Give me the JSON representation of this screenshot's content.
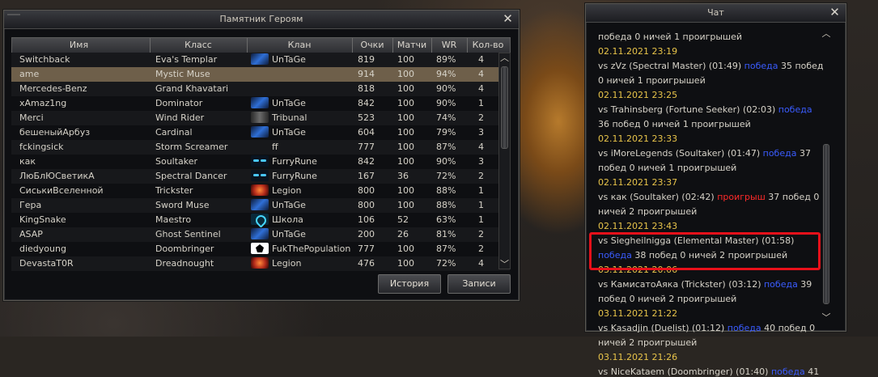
{
  "heroes_window": {
    "title": "Памятник Героям",
    "close_glyph": "✕",
    "columns": [
      "Имя",
      "Класс",
      "Клан",
      "Очки",
      "Матчи",
      "WR",
      "Кол-во"
    ],
    "rows": [
      {
        "name": "Switchback",
        "class": "Eva's Templar",
        "clan": "UnTaGe",
        "clan_icon": "untage-emblem-icon",
        "points": "819",
        "matches": "100",
        "wr": "89%",
        "count": "4"
      },
      {
        "name": "ame",
        "class": "Mystic Muse",
        "clan": "",
        "clan_icon": "",
        "points": "914",
        "matches": "100",
        "wr": "94%",
        "count": "4"
      },
      {
        "name": "Mercedes-Benz",
        "class": "Grand Khavatari",
        "clan": "",
        "clan_icon": "",
        "points": "818",
        "matches": "100",
        "wr": "90%",
        "count": "4"
      },
      {
        "name": "xAmaz1ng",
        "class": "Dominator",
        "clan": "UnTaGe",
        "clan_icon": "untage-emblem-icon",
        "points": "842",
        "matches": "100",
        "wr": "90%",
        "count": "1"
      },
      {
        "name": "Merci",
        "class": "Wind Rider",
        "clan": "Tribunal",
        "clan_icon": "tribunal-emblem-icon",
        "points": "523",
        "matches": "100",
        "wr": "74%",
        "count": "2"
      },
      {
        "name": "бешеныйАрбуз",
        "class": "Cardinal",
        "clan": "UnTaGe",
        "clan_icon": "untage-emblem-icon",
        "points": "604",
        "matches": "100",
        "wr": "79%",
        "count": "3"
      },
      {
        "name": "fckingsick",
        "class": "Storm Screamer",
        "clan": "ff",
        "clan_icon": "",
        "points": "777",
        "matches": "100",
        "wr": "87%",
        "count": "4"
      },
      {
        "name": "как",
        "class": "Soultaker",
        "clan": "FurryRune",
        "clan_icon": "furryrune-emblem-icon",
        "points": "842",
        "matches": "100",
        "wr": "90%",
        "count": "3"
      },
      {
        "name": "ЛюБлЮСветикА",
        "class": "Spectral Dancer",
        "clan": "FurryRune",
        "clan_icon": "furryrune-emblem-icon",
        "points": "167",
        "matches": "36",
        "wr": "72%",
        "count": "2"
      },
      {
        "name": "СиськиВселенной",
        "class": "Trickster",
        "clan": "Legion",
        "clan_icon": "legion-emblem-icon",
        "points": "800",
        "matches": "100",
        "wr": "88%",
        "count": "1"
      },
      {
        "name": "Гера",
        "class": "Sword Muse",
        "clan": "UnTaGe",
        "clan_icon": "untage-emblem-icon",
        "points": "800",
        "matches": "100",
        "wr": "88%",
        "count": "1"
      },
      {
        "name": "KingSnake",
        "class": "Maestro",
        "clan": "Школа",
        "clan_icon": "shkola-emblem-icon",
        "points": "106",
        "matches": "52",
        "wr": "63%",
        "count": "1"
      },
      {
        "name": "ASAP",
        "class": "Ghost Sentinel",
        "clan": "UnTaGe",
        "clan_icon": "untage-emblem-icon",
        "points": "200",
        "matches": "26",
        "wr": "81%",
        "count": "2"
      },
      {
        "name": "diedyoung",
        "class": "Doombringer",
        "clan": "FukThePopulation",
        "clan_icon": "fukthepopulation-emblem-icon",
        "points": "777",
        "matches": "100",
        "wr": "87%",
        "count": "2"
      },
      {
        "name": "DevastaT0R",
        "class": "Dreadnought",
        "clan": "Legion",
        "clan_icon": "legion-emblem-icon",
        "points": "476",
        "matches": "100",
        "wr": "72%",
        "count": "4"
      }
    ],
    "selected_row": 1,
    "buttons": {
      "history": "История",
      "records": "Записи"
    },
    "scroll_up": "︿",
    "scroll_down": "﹀"
  },
  "chat_window": {
    "title": "Чат",
    "close_glyph": "✕",
    "scroll_up": "︿",
    "scroll_down": "﹀",
    "lines": [
      {
        "parts": [
          {
            "t": "победа 0 ничей 1 проигрышей",
            "c": "normal"
          }
        ]
      },
      {
        "parts": [
          {
            "t": "02.11.2021 23:19",
            "c": "date"
          }
        ]
      },
      {
        "parts": [
          {
            "t": "vs zVz (Spectral Master) (01:49) ",
            "c": "normal"
          },
          {
            "t": "победа",
            "c": "win"
          },
          {
            "t": " 35 побед",
            "c": "normal"
          }
        ]
      },
      {
        "parts": [
          {
            "t": "0 ничей 1 проигрышей",
            "c": "normal"
          }
        ]
      },
      {
        "parts": [
          {
            "t": "02.11.2021 23:25",
            "c": "date"
          }
        ]
      },
      {
        "parts": [
          {
            "t": "vs Trahinsberg (Fortune Seeker) (02:03) ",
            "c": "normal"
          },
          {
            "t": "победа",
            "c": "win"
          }
        ]
      },
      {
        "parts": [
          {
            "t": "36 побед 0 ничей 1 проигрышей",
            "c": "normal"
          }
        ]
      },
      {
        "parts": [
          {
            "t": "02.11.2021 23:33",
            "c": "date"
          }
        ]
      },
      {
        "parts": [
          {
            "t": "vs iMoreLegends (Soultaker) (01:47) ",
            "c": "normal"
          },
          {
            "t": "победа",
            "c": "win"
          },
          {
            "t": " 37",
            "c": "normal"
          }
        ]
      },
      {
        "parts": [
          {
            "t": "побед 0 ничей 1 проигрышей",
            "c": "normal"
          }
        ]
      },
      {
        "parts": [
          {
            "t": "02.11.2021 23:37",
            "c": "date"
          }
        ]
      },
      {
        "parts": [
          {
            "t": "vs как (Soultaker) (02:42) ",
            "c": "normal"
          },
          {
            "t": "проигрыш",
            "c": "lose"
          },
          {
            "t": " 37 побед 0",
            "c": "normal"
          }
        ]
      },
      {
        "parts": [
          {
            "t": "ничей 2 проигрышей",
            "c": "normal"
          }
        ]
      },
      {
        "parts": [
          {
            "t": "02.11.2021 23:43",
            "c": "date"
          }
        ]
      },
      {
        "parts": [
          {
            "t": "vs Siegheilnigga (Elemental Master) (01:58)",
            "c": "normal"
          }
        ]
      },
      {
        "parts": [
          {
            "t": "победа",
            "c": "win"
          },
          {
            "t": " 38 побед 0 ничей 2 проигрышей",
            "c": "normal"
          }
        ]
      },
      {
        "parts": [
          {
            "t": "03.11.2021 20:06",
            "c": "date"
          }
        ]
      },
      {
        "parts": [
          {
            "t": "vs КамисатоАяка (Trickster) (03:12) ",
            "c": "normal"
          },
          {
            "t": "победа",
            "c": "win"
          },
          {
            "t": " 39",
            "c": "normal"
          }
        ]
      },
      {
        "parts": [
          {
            "t": "побед 0 ничей 2 проигрышей",
            "c": "normal"
          }
        ]
      },
      {
        "parts": [
          {
            "t": "03.11.2021 21:22",
            "c": "date"
          }
        ]
      },
      {
        "parts": [
          {
            "t": "vs Kasadjin (Duelist) (01:12) ",
            "c": "normal"
          },
          {
            "t": "победа",
            "c": "win"
          },
          {
            "t": " 40 побед 0",
            "c": "normal"
          }
        ]
      },
      {
        "parts": [
          {
            "t": "ничей 2 проигрышей",
            "c": "normal"
          }
        ]
      },
      {
        "parts": [
          {
            "t": "03.11.2021 21:26",
            "c": "date"
          }
        ]
      },
      {
        "parts": [
          {
            "t": "vs NiceKataem (Doombringer) (01:40) ",
            "c": "normal"
          },
          {
            "t": "победа",
            "c": "win"
          },
          {
            "t": " 41",
            "c": "normal"
          }
        ]
      }
    ]
  },
  "colors": {
    "date": "#e8c44a",
    "win": "#3a5cff",
    "lose": "#ff2a2a",
    "highlight_box": "#e8101a",
    "selected_row": "#6e5f4a"
  }
}
